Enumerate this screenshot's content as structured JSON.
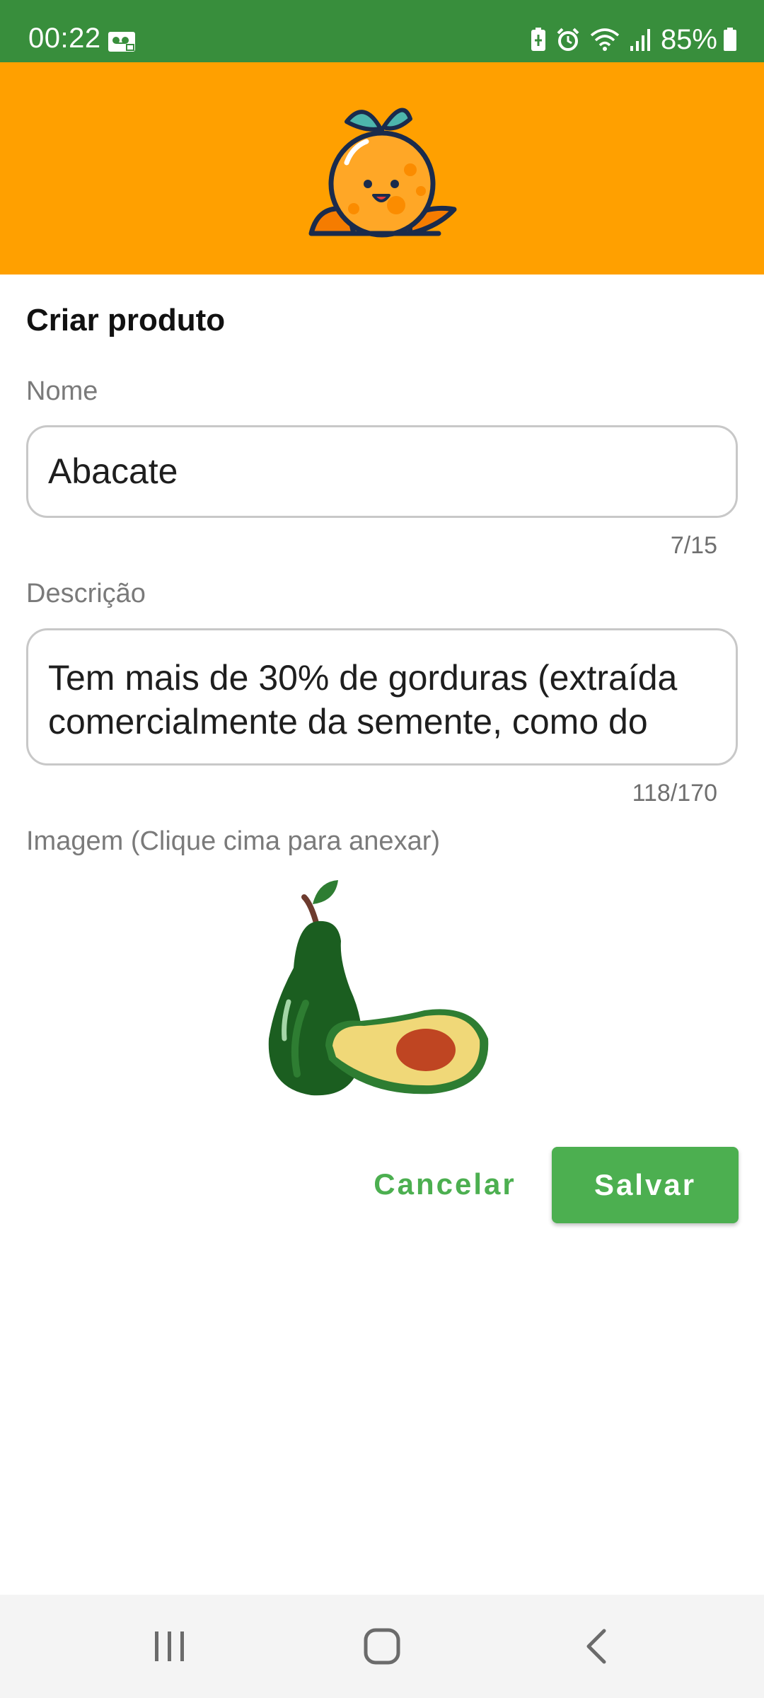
{
  "status_bar": {
    "time": "00:22",
    "battery_percent": "85%",
    "icons": [
      "voicemail-icon",
      "battery-saver-icon",
      "alarm-icon",
      "wifi-icon",
      "cellular-signal-icon",
      "battery-icon"
    ]
  },
  "header": {
    "logo": "orange-mascot-logo",
    "background_color": "#ffa000"
  },
  "form": {
    "title": "Criar produto",
    "name": {
      "label": "Nome",
      "value": "Abacate",
      "counter": "7/15"
    },
    "description": {
      "label": "Descrição",
      "value_line1": "Tem mais de 30% de gorduras (extraída",
      "value_line2": "comercialmente da semente, como do",
      "counter": "118/170"
    },
    "image": {
      "label": "Imagem (Clique cima para anexar)",
      "picture": "avocado-image"
    }
  },
  "actions": {
    "cancel_label": "Cancelar",
    "save_label": "Salvar",
    "accent_color": "#4caf50"
  },
  "navigation_bar": {
    "buttons": [
      "recents-icon",
      "home-icon",
      "back-icon"
    ]
  }
}
